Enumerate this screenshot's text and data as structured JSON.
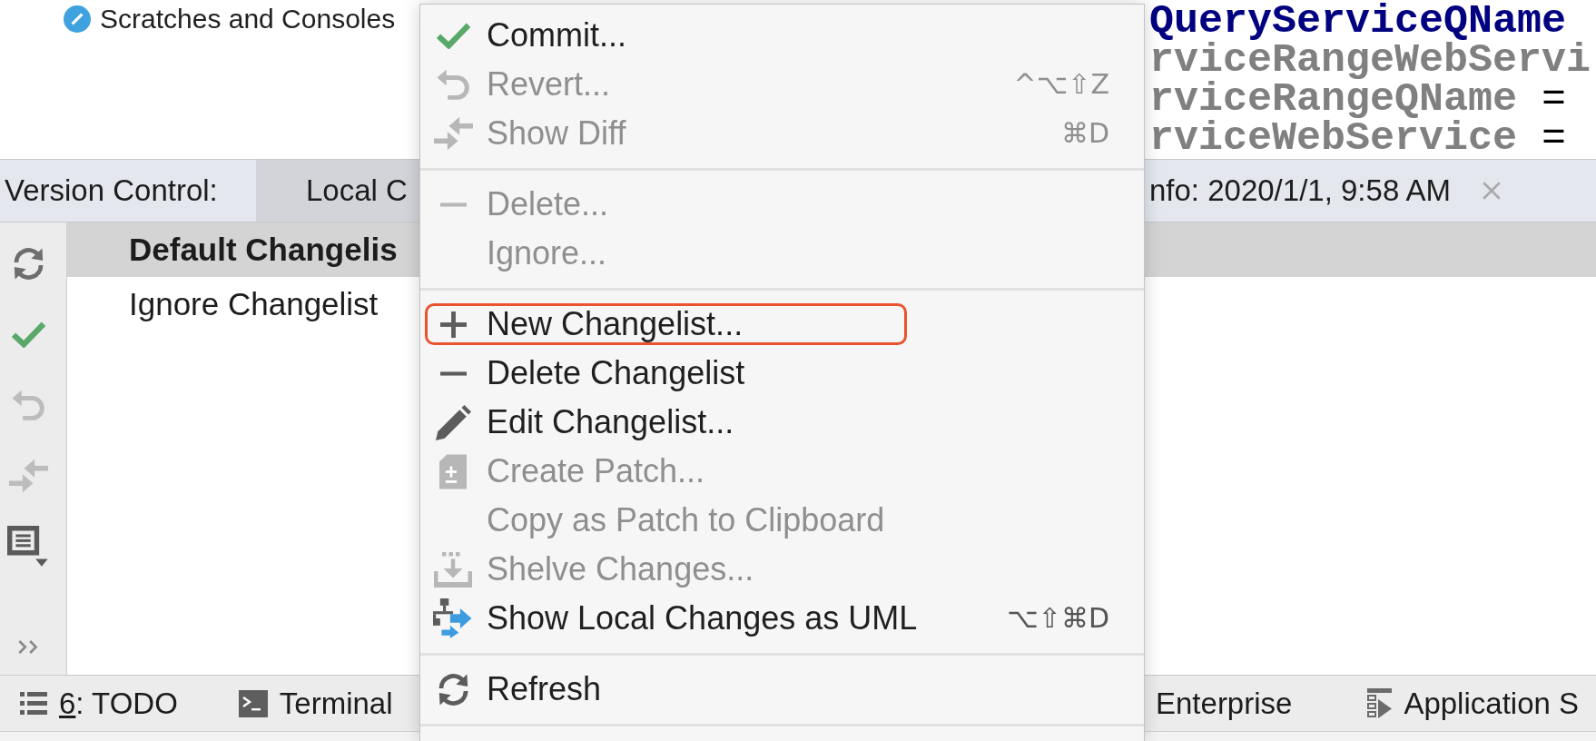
{
  "project_tree": {
    "items": [
      {
        "label": "Scratches and Consoles"
      }
    ]
  },
  "editor": {
    "lines": [
      {
        "text": "QueryServiceQName",
        "color": "#000080"
      },
      {
        "text": "rviceRangeWebServi",
        "color": "#808080"
      },
      {
        "text": "rviceRangeQName",
        "color": "#808080",
        "operator": "="
      },
      {
        "text": "rviceWebService",
        "color": "#808080",
        "operator": "="
      }
    ]
  },
  "tool_window": {
    "title": "Version Control:",
    "tabs": [
      {
        "label": "Local C",
        "selected": true
      },
      {
        "label": "nfo: 2020/1/1, 9:58 AM",
        "selected": false,
        "closable": true
      }
    ],
    "toolbar": [
      {
        "disabled": false
      },
      {
        "disabled": false
      },
      {
        "disabled": true
      },
      {
        "disabled": true
      },
      {
        "disabled": false
      }
    ],
    "changelists": [
      {
        "label": "Default Changelis",
        "selected": true,
        "default": true
      },
      {
        "label": "Ignore Changelist",
        "selected": false,
        "default": false
      }
    ]
  },
  "context_menu": {
    "groups": [
      [
        {
          "label": "Commit...",
          "disabled": false,
          "highlighted": false
        },
        {
          "label": "Revert...",
          "shortcut": "^⌥⇧Z",
          "disabled": true,
          "highlighted": false
        },
        {
          "label": "Show Diff",
          "shortcut": "⌘D",
          "disabled": true,
          "highlighted": false
        }
      ],
      [
        {
          "label": "Delete...",
          "disabled": true,
          "highlighted": false
        },
        {
          "label": "Ignore...",
          "disabled": true,
          "highlighted": false
        }
      ],
      [
        {
          "label": "New Changelist...",
          "disabled": false,
          "highlighted": true
        },
        {
          "label": "Delete Changelist",
          "disabled": false,
          "highlighted": false
        },
        {
          "label": "Edit Changelist...",
          "disabled": false,
          "highlighted": false
        },
        {
          "label": "Create Patch...",
          "disabled": true,
          "highlighted": false
        },
        {
          "label": "Copy as Patch to Clipboard",
          "disabled": true,
          "highlighted": false
        },
        {
          "label": "Shelve Changes...",
          "disabled": true,
          "highlighted": false
        },
        {
          "label": "Show Local Changes as UML",
          "shortcut": "⌥⇧⌘D",
          "disabled": false,
          "highlighted": false
        }
      ],
      [
        {
          "label": "Refresh",
          "disabled": false,
          "highlighted": false
        }
      ]
    ]
  },
  "tool_strip": {
    "items": [
      {
        "mnemonic": "6",
        "label": ": TODO"
      },
      {
        "label": "Terminal"
      },
      {
        "label": "Enterprise"
      },
      {
        "label": "Application S"
      }
    ]
  }
}
